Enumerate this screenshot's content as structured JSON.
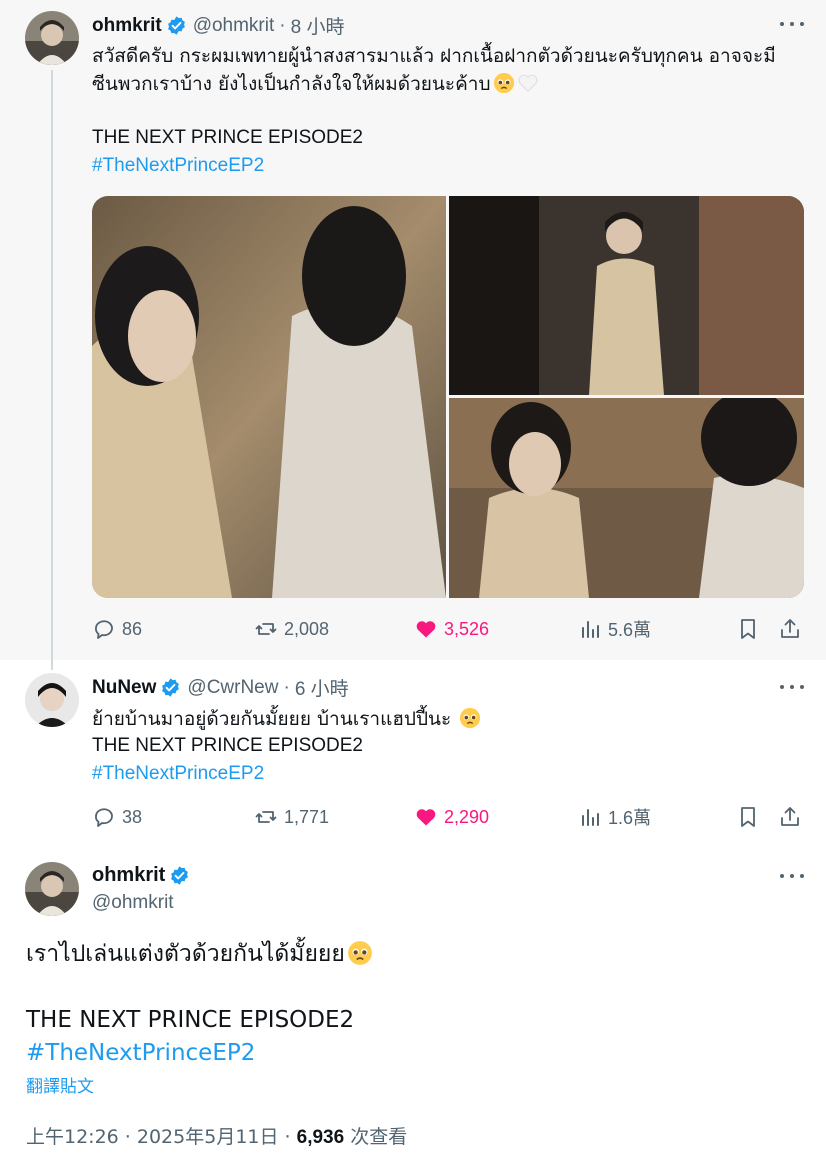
{
  "tweets": [
    {
      "name": "ohmkrit",
      "handle": "@ohmkrit",
      "time": "8 小時",
      "lines": [
        "สวัสดีครับ กระผมเพทายผู้นำสงสารมาแล้ว ฝากเนื้อฝากตัวด้วยนะครับทุกคน อาจจะมี",
        "ซีนพวกเราบ้าง ยังไงเป็นกำลังใจให้ผมด้วยนะค้าบ"
      ],
      "title_line": "THE NEXT PRINCE EPISODE2",
      "hashtag": "#TheNextPrinceEP2",
      "stats": {
        "replies": "86",
        "retweets": "2,008",
        "likes": "3,526",
        "views": "5.6萬"
      }
    },
    {
      "name": "NuNew",
      "handle": "@CwrNew",
      "time": "6 小時",
      "lines": [
        "ย้ายบ้านมาอยู่ด้วยกันมั้ยยย บ้านเราแฮปปี้นะ"
      ],
      "title_line": "THE NEXT PRINCE EPISODE2",
      "hashtag": "#TheNextPrinceEP2",
      "stats": {
        "replies": "38",
        "retweets": "1,771",
        "likes": "2,290",
        "views": "1.6萬"
      }
    }
  ],
  "main_tweet": {
    "name": "ohmkrit",
    "handle": "@ohmkrit",
    "text": "เราไปเล่นแต่งตัวด้วยกันได้มั้ยยย",
    "title_line": "THE NEXT PRINCE EPISODE2",
    "hashtag": "#TheNextPrinceEP2",
    "translate": "翻譯貼文",
    "timestamp": "上午12:26 · 2025年5月11日 · ",
    "views_count": "6,936",
    "views_label": " 次查看"
  },
  "dot": "·",
  "colors": {
    "accent": "#1d9bf0",
    "like": "#f91880",
    "muted": "#536471",
    "verified": "#1d9bf0"
  },
  "icons": [
    "reply-icon",
    "retweet-icon",
    "heart-icon",
    "views-icon",
    "bookmark-icon",
    "share-icon",
    "verified-badge-icon",
    "more-icon",
    "pleading-face-emoji",
    "white-heart-emoji"
  ]
}
